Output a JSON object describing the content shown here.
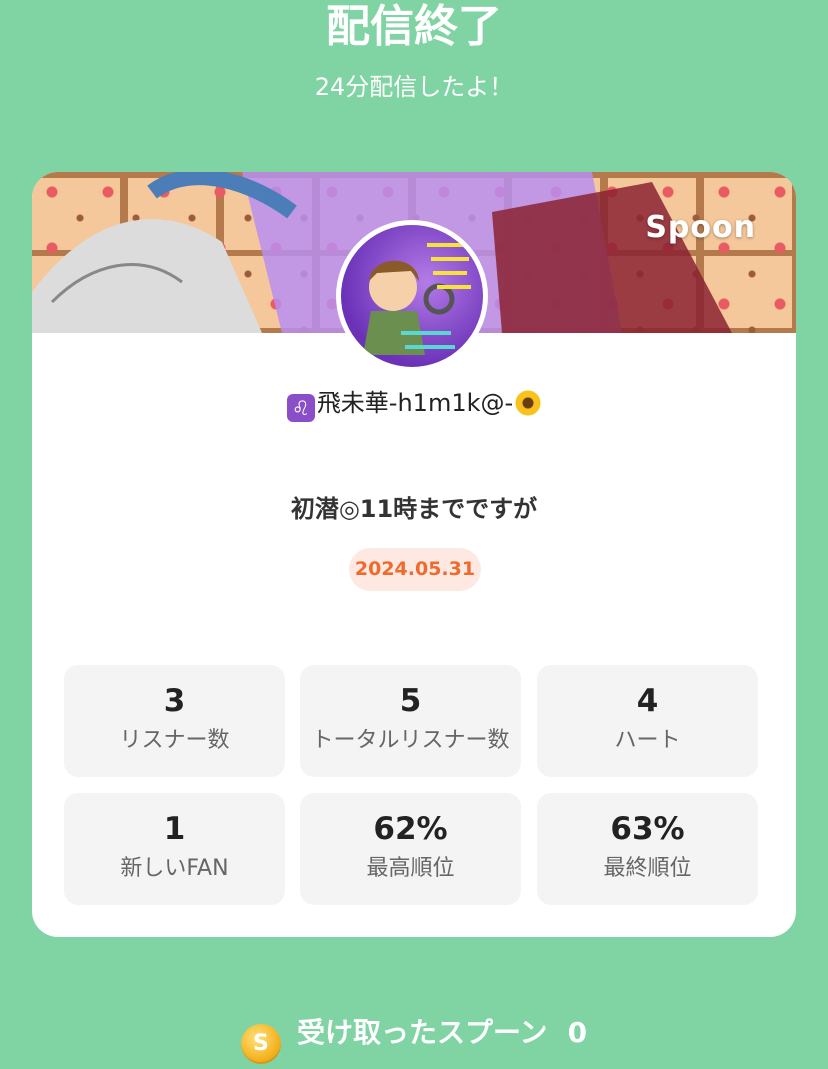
{
  "header": {
    "title": "配信終了",
    "subtitle": "24分配信したよ！"
  },
  "card": {
    "brand": "Spoon",
    "username": "飛未華-h1m1k@-",
    "broadcast_title": "初潜◎11時までですが",
    "date": "2024.05.31",
    "stats": [
      {
        "value": "3",
        "label": "リスナー数"
      },
      {
        "value": "5",
        "label": "トータルリスナー数"
      },
      {
        "value": "4",
        "label": "ハート"
      },
      {
        "value": "1",
        "label": "新しいFAN"
      },
      {
        "value": "62%",
        "label": "最高順位"
      },
      {
        "value": "63%",
        "label": "最終順位"
      }
    ]
  },
  "footer": {
    "label": "受け取ったスプーン",
    "amount": "0"
  },
  "colors": {
    "background": "#80d4a4",
    "date_text": "#ef6a2e",
    "date_bg": "#fde9e1"
  }
}
